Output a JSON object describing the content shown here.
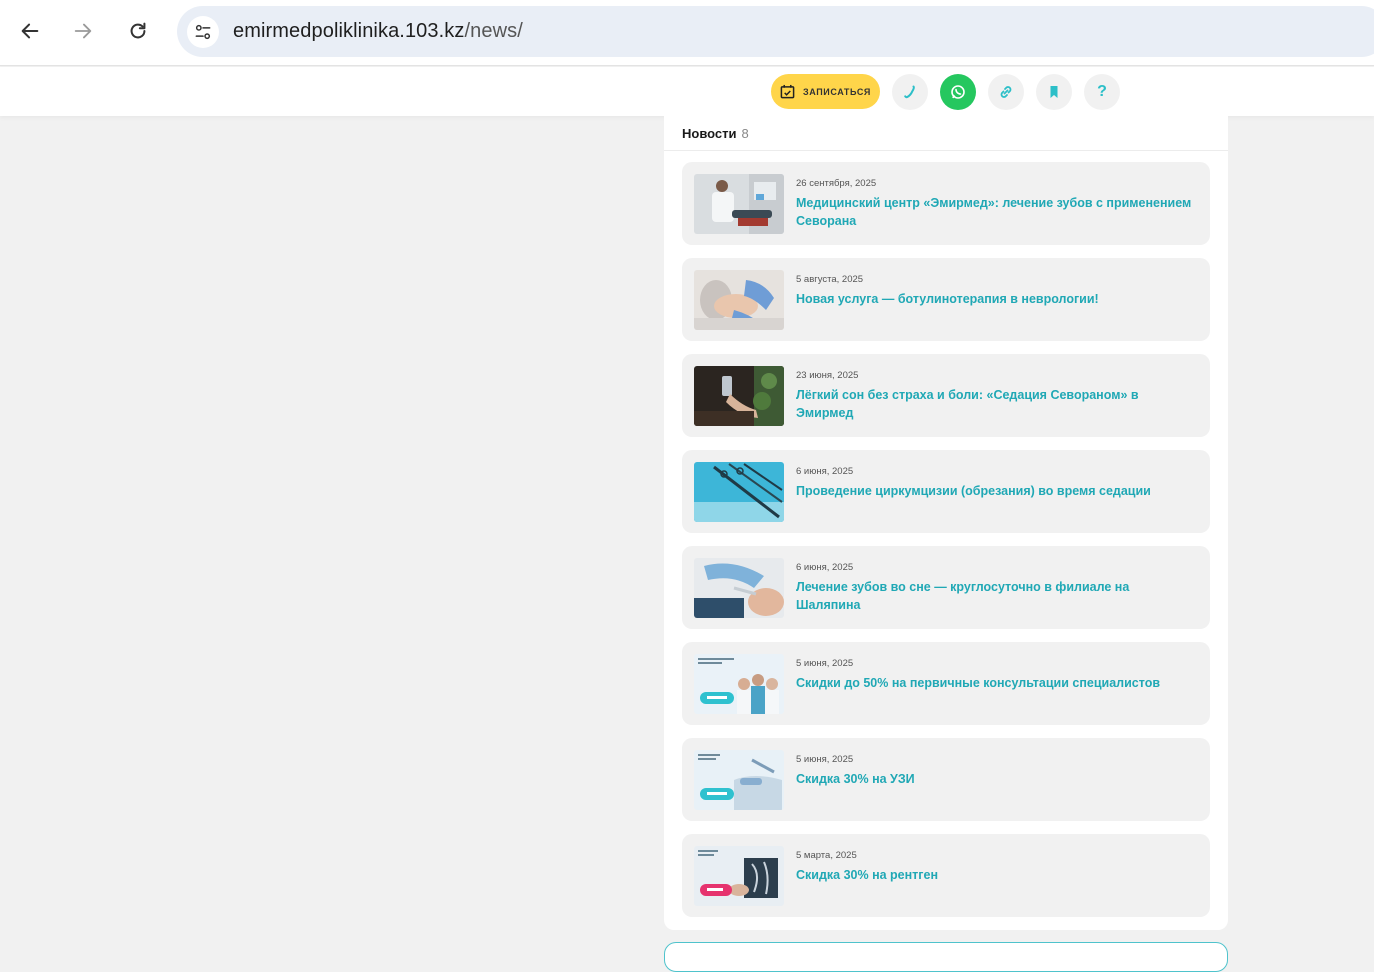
{
  "browser": {
    "url_host": "emirmedpoliklinika.103.kz",
    "url_path": "/news/"
  },
  "header": {
    "book_label": "ЗАПИСАТЬСЯ",
    "help_label": "?"
  },
  "news": {
    "title": "Новости",
    "count": "8",
    "items": [
      {
        "date": "26 сентября, 2025",
        "title": "Медицинский центр «Эмирмед»: лечение зубов с применением Севорана",
        "thumb": "dentist-photo"
      },
      {
        "date": "5 августа, 2025",
        "title": "Новая услуга — ботулинотерапия в неврологии!",
        "thumb": "injection-photo"
      },
      {
        "date": "23 июня, 2025",
        "title": "Лёгкий сон без страха и боли: «Седация Севораном» в Эмирмед",
        "thumb": "sedation-photo"
      },
      {
        "date": "6 июня, 2025",
        "title": "Проведение циркумцизии (обрезания) во время седации",
        "thumb": "instruments-photo"
      },
      {
        "date": "6 июня, 2025",
        "title": "Лечение зубов во сне — круглосуточно в филиале на Шаляпина",
        "thumb": "dental-treatment-photo"
      },
      {
        "date": "5 июня, 2025",
        "title": "Скидки до 50% на первичные консультации специалистов",
        "thumb": "doctors-promo"
      },
      {
        "date": "5 июня, 2025",
        "title": "Скидка 30% на УЗИ",
        "thumb": "ultrasound-promo"
      },
      {
        "date": "5 марта, 2025",
        "title": "Скидка 30% на рентген",
        "thumb": "xray-promo"
      }
    ]
  },
  "colors": {
    "accent": "#20a8b5",
    "book_button": "#ffd54a",
    "whatsapp": "#25c75f"
  }
}
